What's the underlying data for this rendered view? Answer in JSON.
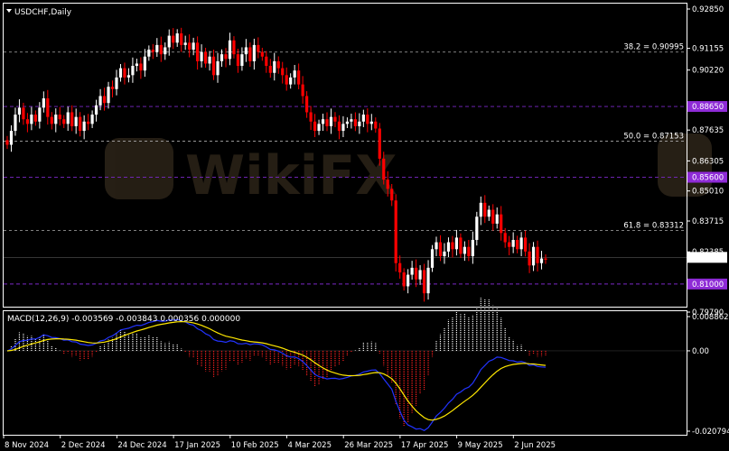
{
  "symbol_label": "USDCHF,Daily",
  "watermark_text": "WikiFX",
  "macd_label": "MACD(12,26,9) -0.003569 -0.003843 0.000356 0.000000",
  "colors": {
    "background": "#000000",
    "bull": "#ffffff",
    "bear": "#ff0000",
    "grid": "#ffffff",
    "fib_line": "#aaaaaa",
    "level_line": "#7b28c8",
    "level_badge": "#8e2bd6",
    "current_badge": "#ffffff",
    "macd_main": "#2233ff",
    "macd_signal": "#ffe800",
    "hist_up": "#ffffff",
    "hist_down": "#ff2020"
  },
  "chart_data": [
    {
      "type": "candlestick",
      "title": "USDCHF,Daily",
      "ylim": [
        0.7979,
        0.9285
      ],
      "y_ticks": [
        {
          "value": 0.9285,
          "label": "0.92850"
        },
        {
          "value": 0.91155,
          "label": "0.91155"
        },
        {
          "value": 0.9022,
          "label": "0.90220"
        },
        {
          "value": 0.8863,
          "label": "0.88630"
        },
        {
          "value": 0.87635,
          "label": "0.87635"
        },
        {
          "value": 0.86305,
          "label": "0.86305"
        },
        {
          "value": 0.8501,
          "label": "0.85010"
        },
        {
          "value": 0.83715,
          "label": "0.83715"
        },
        {
          "value": 0.82385,
          "label": "0.82385"
        },
        {
          "value": 0.7979,
          "label": "0.79790"
        }
      ],
      "x_labels": [
        "8 Nov 2024",
        "2 Dec 2024",
        "24 Dec 2024",
        "17 Jan 2025",
        "10 Feb 2025",
        "4 Mar 2025",
        "26 Mar 2025",
        "17 Apr 2025",
        "9 May 2025",
        "2 Jun 2025"
      ],
      "fib_levels": [
        {
          "value": 0.90995,
          "label": "38.2 = 0.90995"
        },
        {
          "value": 0.87153,
          "label": "50.0 = 0.87153"
        },
        {
          "value": 0.83312,
          "label": "61.8 = 0.83312"
        }
      ],
      "horizontal_levels": [
        {
          "value": 0.8865,
          "label": "0.88650"
        },
        {
          "value": 0.856,
          "label": "0.85600"
        },
        {
          "value": 0.81,
          "label": "0.81000"
        }
      ],
      "current_price": {
        "value": 0.82148,
        "label": "0.82148"
      },
      "closes": [
        0.87,
        0.876,
        0.883,
        0.886,
        0.881,
        0.879,
        0.883,
        0.88,
        0.886,
        0.89,
        0.882,
        0.879,
        0.883,
        0.881,
        0.879,
        0.884,
        0.878,
        0.882,
        0.876,
        0.88,
        0.879,
        0.883,
        0.887,
        0.891,
        0.888,
        0.895,
        0.894,
        0.899,
        0.903,
        0.899,
        0.9,
        0.904,
        0.905,
        0.902,
        0.908,
        0.911,
        0.91,
        0.913,
        0.909,
        0.912,
        0.917,
        0.914,
        0.918,
        0.913,
        0.914,
        0.911,
        0.914,
        0.906,
        0.91,
        0.905,
        0.908,
        0.9,
        0.906,
        0.909,
        0.907,
        0.915,
        0.909,
        0.904,
        0.909,
        0.912,
        0.906,
        0.913,
        0.91,
        0.908,
        0.904,
        0.901,
        0.906,
        0.903,
        0.9,
        0.896,
        0.899,
        0.902,
        0.896,
        0.891,
        0.884,
        0.88,
        0.876,
        0.879,
        0.881,
        0.878,
        0.882,
        0.88,
        0.876,
        0.879,
        0.88,
        0.881,
        0.878,
        0.88,
        0.883,
        0.879,
        0.88,
        0.877,
        0.864,
        0.855,
        0.851,
        0.846,
        0.819,
        0.815,
        0.809,
        0.814,
        0.817,
        0.812,
        0.816,
        0.806,
        0.817,
        0.825,
        0.828,
        0.822,
        0.824,
        0.828,
        0.825,
        0.83,
        0.823,
        0.826,
        0.822,
        0.829,
        0.839,
        0.845,
        0.839,
        0.842,
        0.836,
        0.84,
        0.832,
        0.828,
        0.826,
        0.829,
        0.825,
        0.83,
        0.824,
        0.818,
        0.826,
        0.819,
        0.821,
        0.8205
      ]
    },
    {
      "type": "macd",
      "title": "MACD(12,26,9) -0.003569 -0.003843 0.000356 0.000000",
      "ylim": [
        -0.020794,
        0.008862
      ],
      "y_ticks": [
        {
          "value": 0.008862,
          "label": "0.008862"
        },
        {
          "value": 0.0,
          "label": "0.00"
        },
        {
          "value": -0.020794,
          "label": "-0.020794"
        }
      ]
    }
  ]
}
